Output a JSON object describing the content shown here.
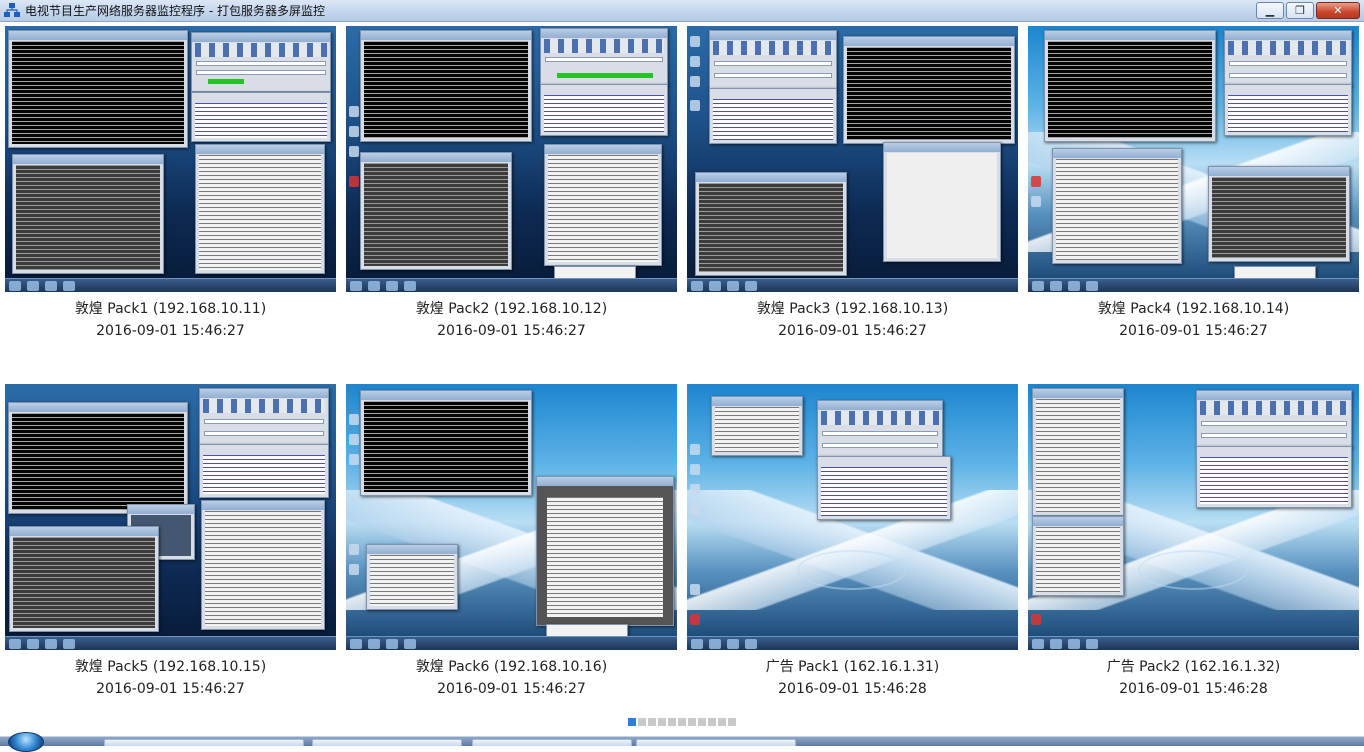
{
  "window": {
    "title": "电视节目生产网络服务器监控程序 - 打包服务器多屏监控",
    "minimize_icon": "minimize-icon",
    "maximize_icon": "restore-icon",
    "close_icon": "close-icon"
  },
  "screens": [
    {
      "name": "敦煌 Pack1 (192.168.10.11)",
      "time": "2016-09-01 15:46:27"
    },
    {
      "name": "敦煌 Pack2 (192.168.10.12)",
      "time": "2016-09-01 15:46:27"
    },
    {
      "name": "敦煌 Pack3 (192.168.10.13)",
      "time": "2016-09-01 15:46:27"
    },
    {
      "name": "敦煌 Pack4 (192.168.10.14)",
      "time": "2016-09-01 15:46:27"
    },
    {
      "name": "敦煌 Pack5 (192.168.10.15)",
      "time": "2016-09-01 15:46:27"
    },
    {
      "name": "敦煌 Pack6 (192.168.10.16)",
      "time": "2016-09-01 15:46:27"
    },
    {
      "name": "广告 Pack1 (162.16.1.31)",
      "time": "2016-09-01 15:46:28"
    },
    {
      "name": "广告 Pack2 (162.16.1.32)",
      "time": "2016-09-01 15:46:28"
    }
  ],
  "pager": {
    "page_count": 11,
    "current_page": 1
  },
  "colors": {
    "pager_active": "#2c7fd6",
    "pager_inactive": "#c9c9c9",
    "titlebar": "#c4d6ee"
  }
}
